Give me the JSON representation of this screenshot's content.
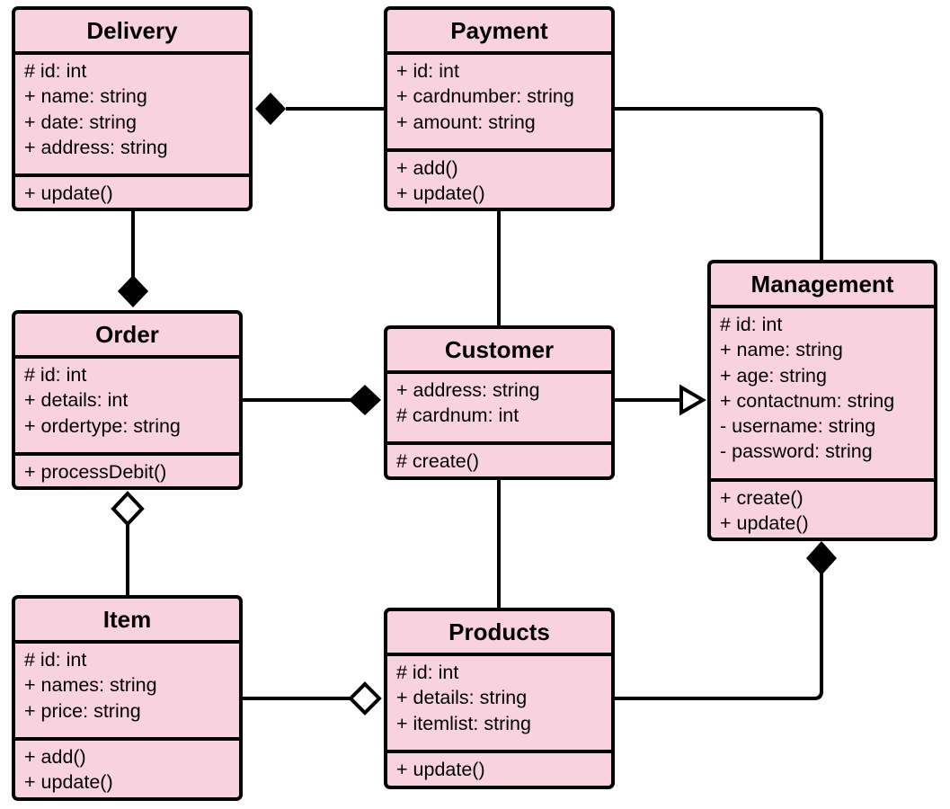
{
  "diagram": {
    "type": "UML class diagram",
    "classes": {
      "delivery": {
        "name": "Delivery",
        "attributes": [
          "# id: int",
          "+ name: string",
          "+ date: string",
          "+ address: string"
        ],
        "methods": [
          "+ update()"
        ]
      },
      "payment": {
        "name": "Payment",
        "attributes": [
          "+ id: int",
          "+ cardnumber: string",
          "+ amount: string"
        ],
        "methods": [
          "+ add()",
          "+ update()"
        ]
      },
      "order": {
        "name": "Order",
        "attributes": [
          "# id: int",
          "+ details: int",
          "+ ordertype: string"
        ],
        "methods": [
          "+ processDebit()"
        ]
      },
      "customer": {
        "name": "Customer",
        "attributes": [
          "+ address: string",
          "# cardnum: int"
        ],
        "methods": [
          "# create()"
        ]
      },
      "management": {
        "name": "Management",
        "attributes": [
          "# id: int",
          "+ name: string",
          "+ age: string",
          "+ contactnum: string",
          "- username: string",
          "- password: string"
        ],
        "methods": [
          "+ create()",
          "+ update()"
        ]
      },
      "item": {
        "name": "Item",
        "attributes": [
          "# id: int",
          "+ names: string",
          "+ price: string"
        ],
        "methods": [
          "+ add()",
          "+ update()"
        ]
      },
      "products": {
        "name": "Products",
        "attributes": [
          "# id: int",
          "+ details: string",
          "+ itemlist: string"
        ],
        "methods": [
          "+ update()"
        ]
      }
    },
    "relationships": [
      {
        "from": "Payment",
        "to": "Delivery",
        "type": "composition",
        "diamond_at": "Delivery"
      },
      {
        "from": "Payment",
        "to": "Management",
        "type": "association"
      },
      {
        "from": "Payment",
        "to": "Customer",
        "type": "association"
      },
      {
        "from": "Delivery",
        "to": "Order",
        "type": "composition",
        "diamond_at": "Order"
      },
      {
        "from": "Order",
        "to": "Customer",
        "type": "composition",
        "diamond_at": "Customer"
      },
      {
        "from": "Customer",
        "to": "Management",
        "type": "generalization",
        "arrow_at": "Management"
      },
      {
        "from": "Item",
        "to": "Order",
        "type": "aggregation",
        "diamond_at": "Order"
      },
      {
        "from": "Item",
        "to": "Products",
        "type": "aggregation",
        "diamond_at": "Products"
      },
      {
        "from": "Customer",
        "to": "Products",
        "type": "association"
      },
      {
        "from": "Products",
        "to": "Management",
        "type": "composition",
        "diamond_at": "Management"
      }
    ],
    "colors": {
      "class_fill": "#f8d3df",
      "stroke": "#000000"
    }
  }
}
